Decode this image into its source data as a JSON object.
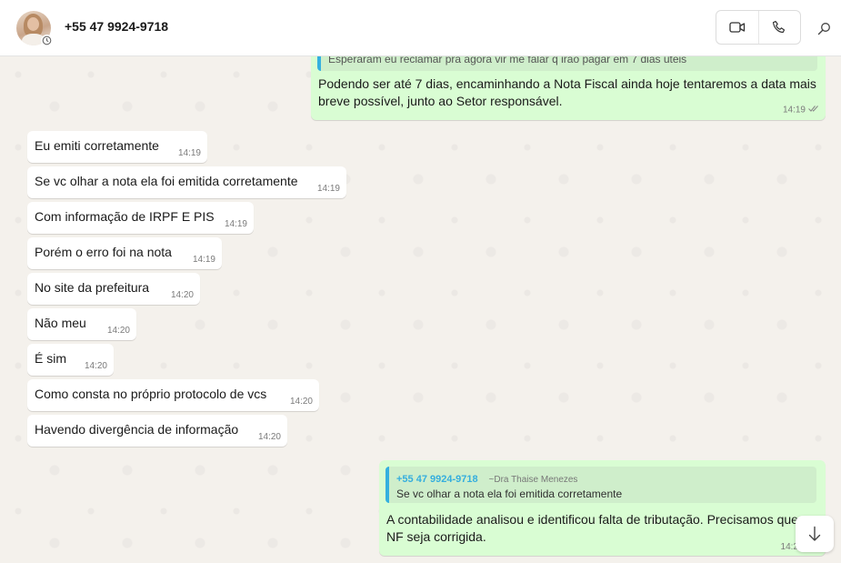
{
  "header": {
    "contact_name": "+55 47 9924-9718",
    "icons": [
      "avatar",
      "status-icon",
      "video-call-icon",
      "voice-call-icon",
      "search-icon"
    ]
  },
  "colors": {
    "outgoing_bubble": "#d9fdd3",
    "incoming_bubble": "#ffffff",
    "quote_bar": "#35b0df",
    "quote_author": "#35aede",
    "chat_background": "#efeae2"
  },
  "messages_top": {
    "quoted_snippet": "Esperaram eu reclamar pra agora vir me falar q irão pagar em 7 dias úteis",
    "text_line1": "Podendo ser até 7 dias, encaminhando a Nota Fiscal ainda hoje tentaremos a data mais",
    "text_line2": "breve possível, junto ao Setor responsável.",
    "time": "14:19"
  },
  "incoming": [
    {
      "text": "Eu emiti corretamente",
      "time": "14:19"
    },
    {
      "text": "Se vc olhar a nota ela foi emitida corretamente",
      "time": "14:19"
    },
    {
      "text": "Com informação de IRPF E PIS",
      "time": "14:19"
    },
    {
      "text": "Porém o erro foi na nota",
      "time": "14:19"
    },
    {
      "text": "No site da prefeitura",
      "time": "14:20"
    },
    {
      "text": "Não meu",
      "time": "14:20"
    },
    {
      "text": "É sim",
      "time": "14:20"
    },
    {
      "text": "Como consta no próprio protocolo de vcs",
      "time": "14:20"
    },
    {
      "text": "Havendo divergência de informação",
      "time": "14:20"
    }
  ],
  "reply": {
    "quote_author": "+55 47 9924-9718",
    "quote_alias": "~Dra Thaise Menezes",
    "quote_text": "Se vc olhar a nota ela foi emitida corretamente",
    "text_line1": "A contabilidade analisou e identificou falta de tributação. Precisamos que",
    "text_line2": "NF seja corrigida.",
    "time": "14:2"
  }
}
